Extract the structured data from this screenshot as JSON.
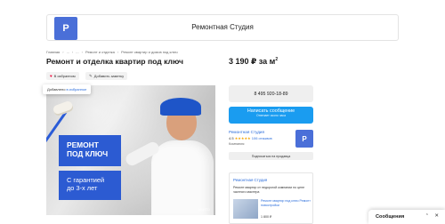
{
  "header": {
    "logo_letter": "P",
    "company_name": "Ремонтная Студия"
  },
  "breadcrumb": [
    "Главная",
    "...",
    "...",
    "Ремонт и отделка",
    "Ремонт квартир и домов под ключ"
  ],
  "listing": {
    "title": "Ремонт и отделка квартир под ключ",
    "price": "3 190 ₽ за м",
    "price_unit_sup": "2"
  },
  "actions": {
    "favorite_label": "В избранном",
    "note_label": "Добавить заметку"
  },
  "tooltip": {
    "text": "Добавлено",
    "link": "в избранное"
  },
  "photo": {
    "promo_line1": "РЕМОНТ",
    "promo_line2": "ПОД КЛЮЧ",
    "promo_sub1": "С гарантией",
    "promo_sub2": "до 3-х лет",
    "watermark": "АВИТО"
  },
  "contact": {
    "phone": "8 495 920-18-89",
    "message_button": "Написать сообщение",
    "message_sub": "Отвечает около часа"
  },
  "seller": {
    "name": "Ремонтная Студия",
    "rating": "4.5",
    "stars": "★★★★★",
    "reviews": "106 отзывов",
    "type": "Компания",
    "avatar_letter": "P",
    "subscribe": "Подписаться на продавца"
  },
  "ad": {
    "title": "Ремонтная Студия",
    "desc": "Ремонт квартир от недорогой компании по цене частного мастера",
    "item_text": "Ремонт квартир под ключ Ремонт новостройки",
    "item_price": "1 800 ₽"
  },
  "messages": {
    "label": "Сообщения",
    "up_icon": "chevron-up-icon",
    "close_icon": "close-icon"
  }
}
